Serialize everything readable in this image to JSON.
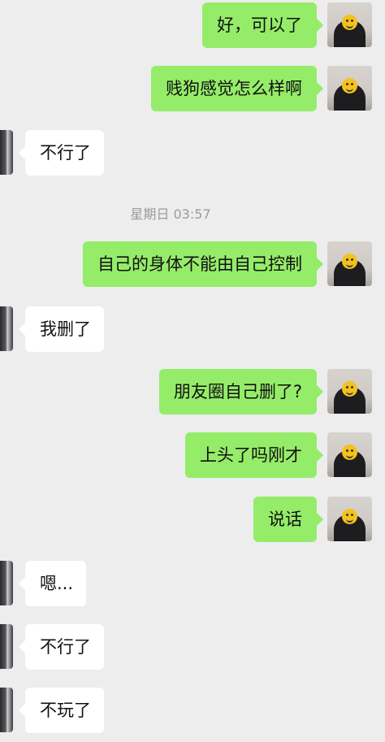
{
  "timestamp": "星期日 03:57",
  "messages": [
    {
      "side": "out",
      "text": "好，可以了"
    },
    {
      "side": "out",
      "text": "贱狗感觉怎么样啊"
    },
    {
      "side": "in",
      "text": "不行了"
    },
    {
      "side": "out",
      "text": "自己的身体不能由自己控制"
    },
    {
      "side": "in",
      "text": "我删了"
    },
    {
      "side": "out",
      "text": "朋友圈自己删了?"
    },
    {
      "side": "out",
      "text": "上头了吗刚才"
    },
    {
      "side": "out",
      "text": "说话"
    },
    {
      "side": "in",
      "text": "嗯..."
    },
    {
      "side": "in",
      "text": "不行了"
    },
    {
      "side": "in",
      "text": "不玩了"
    }
  ],
  "colors": {
    "outgoing_bubble": "#95ec69",
    "incoming_bubble": "#ffffff",
    "background": "#ededed"
  },
  "icons": {
    "my_avatar": "person-emoji-face-avatar",
    "contact_avatar": "contact-avatar"
  }
}
